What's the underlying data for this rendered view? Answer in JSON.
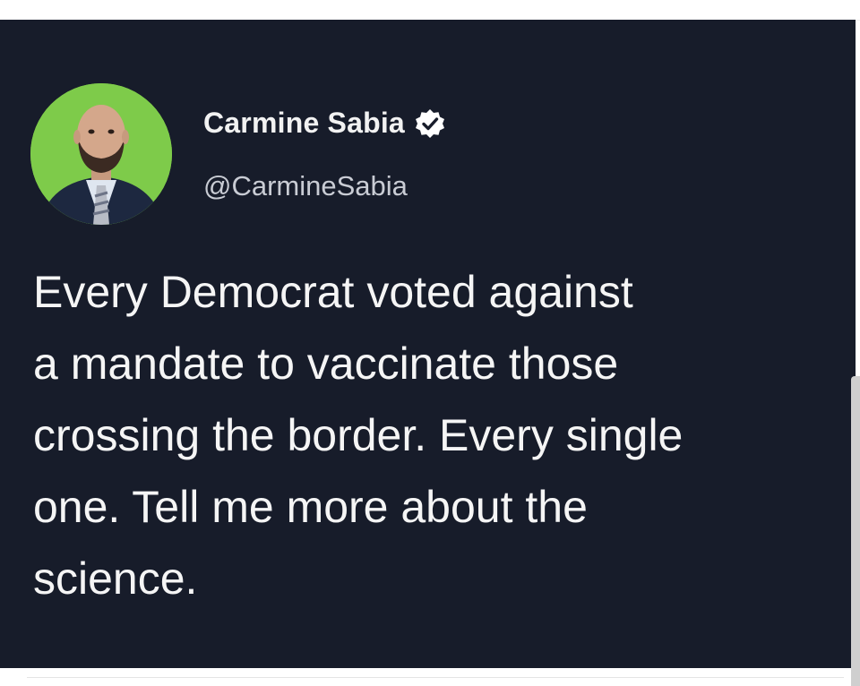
{
  "tweet": {
    "author": {
      "display_name": "Carmine Sabia",
      "handle": "@CarmineSabia",
      "verified": true,
      "avatar_icon": "profile-photo-man-in-suit"
    },
    "text": "Every Democrat voted against\na mandate to vaccinate those\ncrossing the border. Every single\none. Tell me more about the\nscience."
  },
  "colors": {
    "card_background": "#171c2a",
    "avatar_background": "#7ecb4a",
    "text": "#f5f5f5",
    "handle": "#c9ccd4",
    "verified_badge": "#ffffff"
  }
}
